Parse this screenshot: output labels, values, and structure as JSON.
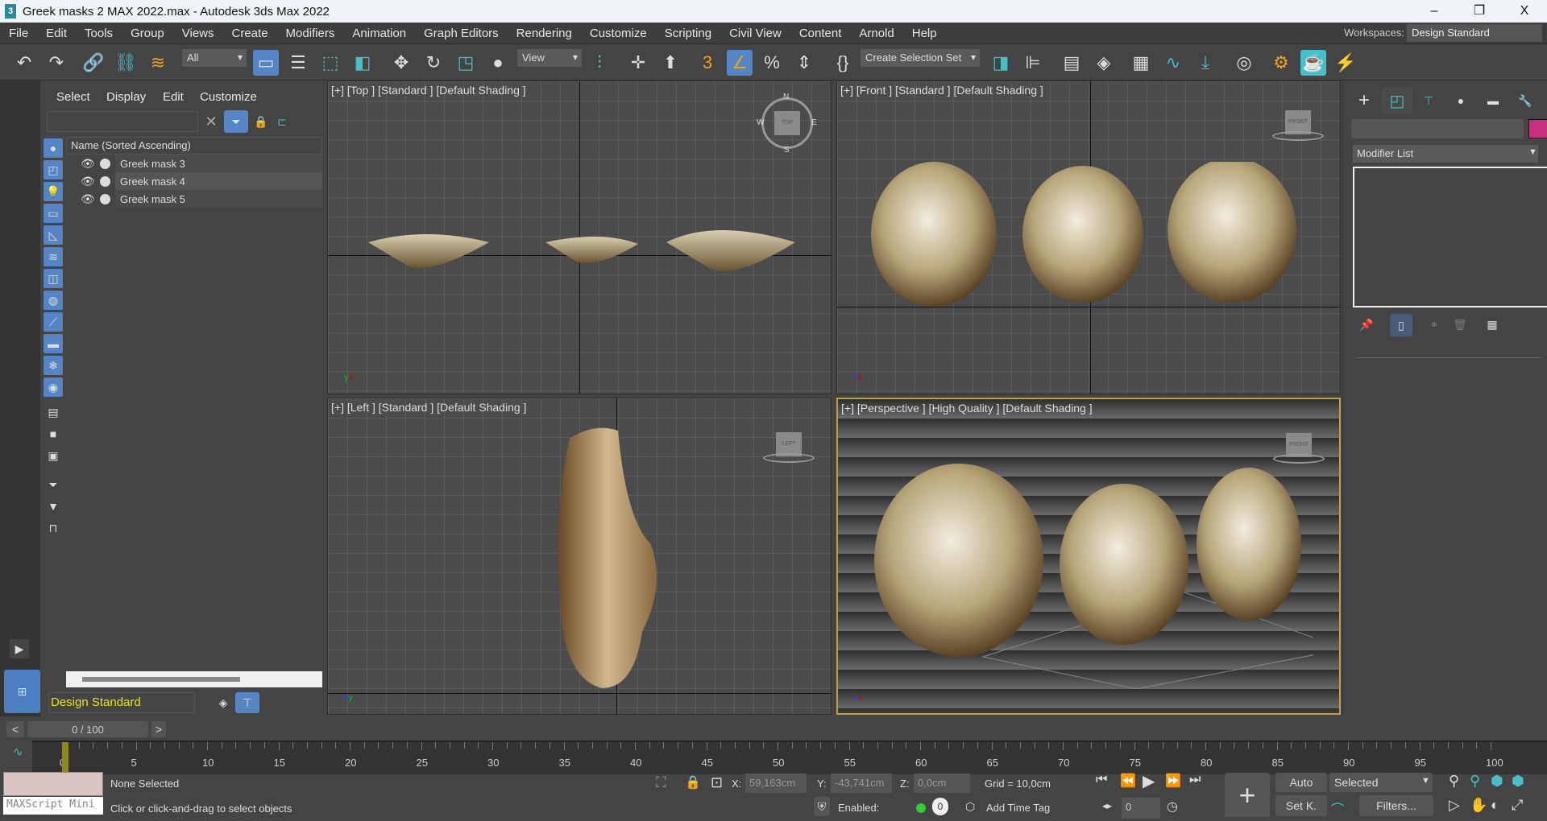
{
  "window": {
    "app_icon": "3",
    "title": "Greek masks 2 MAX 2022.max - Autodesk 3ds Max 2022",
    "minimize": "–",
    "restore": "❐",
    "close": "X"
  },
  "menu": [
    "File",
    "Edit",
    "Tools",
    "Group",
    "Views",
    "Create",
    "Modifiers",
    "Animation",
    "Graph Editors",
    "Rendering",
    "Customize",
    "Scripting",
    "Civil View",
    "Content",
    "Arnold",
    "Help"
  ],
  "workspaces": {
    "label": "Workspaces:",
    "value": "Design Standard"
  },
  "toolbar": {
    "filter": "All",
    "ref_coord": "View",
    "selection_set": "Create Selection Set"
  },
  "explorer": {
    "tabs": [
      "Select",
      "Display",
      "Edit",
      "Customize"
    ],
    "search_placeholder": "",
    "column_header": "Name (Sorted Ascending)",
    "objects": [
      "Greek mask 3",
      "Greek mask 4",
      "Greek mask 5"
    ],
    "workspace": "Design Standard"
  },
  "viewports": [
    {
      "label": "[+] [Top ] [Standard ] [Default Shading ]",
      "cube": "TOP",
      "compass": [
        "N",
        "S",
        "W",
        "E"
      ]
    },
    {
      "label": "[+] [Front ] [Standard ] [Default Shading ]",
      "cube": "FRONT"
    },
    {
      "label": "[+] [Left ] [Standard ] [Default Shading ]",
      "cube": "LEFT"
    },
    {
      "label": "[+] [Perspective ] [High Quality ] [Default Shading ]",
      "cube": "FRONT"
    }
  ],
  "axes": {
    "x": "x",
    "y": "y",
    "z": "z"
  },
  "command_panel": {
    "modifier_list": "Modifier List",
    "object_color": "#c8307e"
  },
  "time": {
    "slider": "0 / 100",
    "prev": "<",
    "next": ">",
    "ticks": [
      0,
      5,
      10,
      15,
      20,
      25,
      30,
      35,
      40,
      45,
      50,
      55,
      60,
      65,
      70,
      75,
      80,
      85,
      90,
      95,
      100
    ],
    "current_frame": 0
  },
  "status": {
    "maxscript": "MAXScript Mini",
    "selection": "None Selected",
    "prompt": "Click or click-and-drag to select objects",
    "x_label": "X:",
    "x": "59,163cm",
    "y_label": "Y:",
    "y": "-43,741cm",
    "z_label": "Z:",
    "z": "0,0cm",
    "grid": "Grid = 10,0cm",
    "enabled_label": "Enabled:",
    "enabled_count": "0",
    "add_time_tag": "Add Time Tag",
    "frame": "0",
    "auto": "Auto",
    "set_key": "Set K.",
    "key_filter": "Selected",
    "filters": "Filters..."
  }
}
